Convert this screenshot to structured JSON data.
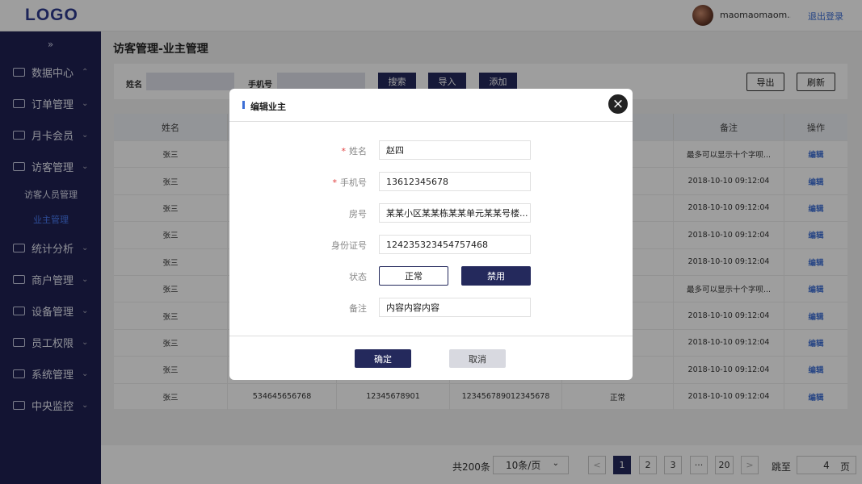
{
  "header": {
    "logo": "LOGO",
    "username": "maomaomaom...",
    "logout": "退出登录"
  },
  "sidebar": {
    "collapse_glyph": "»",
    "items": [
      {
        "label": "数据中心",
        "icon": "bar-chart-icon"
      },
      {
        "label": "订单管理",
        "icon": "order-icon"
      },
      {
        "label": "月卡会员",
        "icon": "vip-icon"
      },
      {
        "label": "访客管理",
        "icon": "visitor-icon"
      },
      {
        "label": "统计分析",
        "icon": "line-chart-icon"
      },
      {
        "label": "商户管理",
        "icon": "merchant-icon"
      },
      {
        "label": "设备管理",
        "icon": "device-icon"
      },
      {
        "label": "员工权限",
        "icon": "staff-icon"
      },
      {
        "label": "系统管理",
        "icon": "system-icon"
      },
      {
        "label": "中央监控",
        "icon": "monitor-icon"
      }
    ],
    "sub_items": [
      "访客人员管理",
      "业主管理"
    ]
  },
  "page": {
    "title": "访客管理-业主管理"
  },
  "filter": {
    "name_label": "姓名",
    "phone_label": "手机号",
    "search": "搜索",
    "import": "导入",
    "add": "添加",
    "export": "导出",
    "refresh": "刷新"
  },
  "table": {
    "headers": [
      "姓名",
      "",
      "",
      "",
      "",
      "备注",
      "操作"
    ],
    "rows": [
      [
        "张三",
        "",
        "",
        "",
        "",
        "最多可以显示十个字呗...",
        "编辑"
      ],
      [
        "张三",
        "",
        "",
        "",
        "",
        "2018-10-10  09:12:04",
        "编辑"
      ],
      [
        "张三",
        "",
        "",
        "",
        "",
        "2018-10-10  09:12:04",
        "编辑"
      ],
      [
        "张三",
        "",
        "",
        "",
        "",
        "2018-10-10  09:12:04",
        "编辑"
      ],
      [
        "张三",
        "",
        "",
        "",
        "",
        "2018-10-10  09:12:04",
        "编辑"
      ],
      [
        "张三",
        "",
        "",
        "",
        "",
        "最多可以显示十个字呗...",
        "编辑"
      ],
      [
        "张三",
        "",
        "",
        "",
        "",
        "2018-10-10  09:12:04",
        "编辑"
      ],
      [
        "张三",
        "",
        "",
        "",
        "",
        "2018-10-10  09:12:04",
        "编辑"
      ],
      [
        "张三",
        "",
        "",
        "",
        "",
        "2018-10-10  09:12:04",
        "编辑"
      ],
      [
        "张三",
        "534645656768",
        "12345678901",
        "123456789012345678",
        "正常",
        "2018-10-10  09:12:04",
        "编辑"
      ]
    ]
  },
  "pagination": {
    "total": "共200条",
    "page_size": "10条/页",
    "pages": [
      "1",
      "2",
      "3",
      "···",
      "20"
    ],
    "current": "1",
    "prev": "<",
    "next": ">",
    "jump_label": "跳至",
    "jump_value": "4",
    "page_unit": "页"
  },
  "modal": {
    "title": "编辑业主",
    "close": "×",
    "fields": {
      "name": {
        "label": "姓名",
        "value": "赵四",
        "required": "*"
      },
      "phone": {
        "label": "手机号",
        "value": "13612345678",
        "required": "*"
      },
      "room": {
        "label": "房号",
        "value": "某某小区某某栋某某单元某某号楼..."
      },
      "id_card": {
        "label": "身份证号",
        "value": "124235323454757468"
      },
      "status": {
        "label": "状态",
        "options": [
          "正常",
          "禁用"
        ],
        "selected": "禁用"
      },
      "remark": {
        "label": "备注",
        "value": "内容内容内容"
      }
    },
    "confirm": "确定",
    "cancel": "取消"
  },
  "colors": {
    "sidebar": "#1f2153",
    "primary": "#24295c",
    "link": "#3d6fd6",
    "required": "#e04040"
  }
}
